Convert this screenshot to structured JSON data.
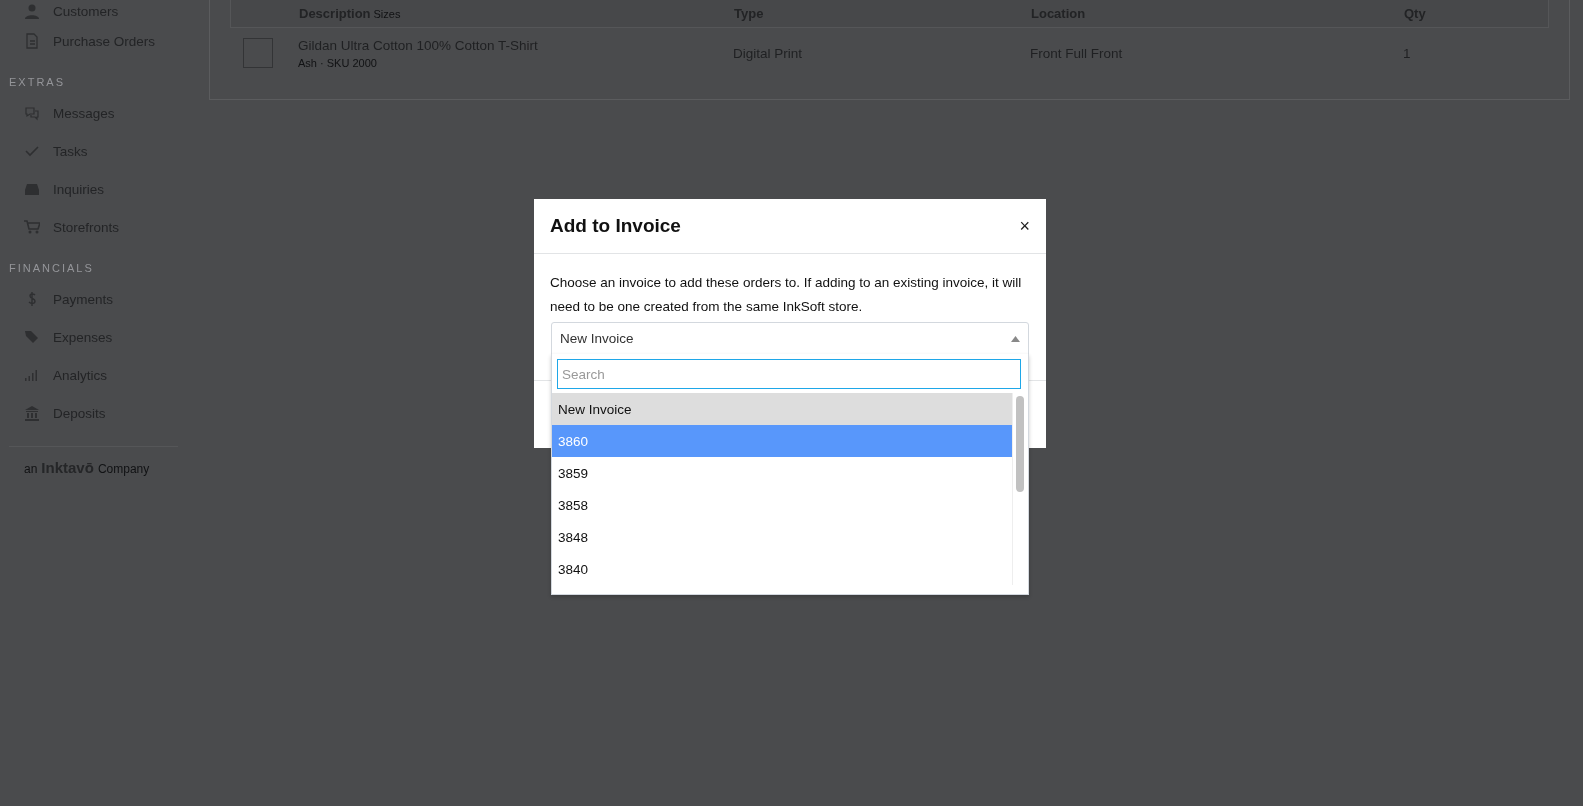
{
  "sidebar": {
    "sections": [
      {
        "items": [
          {
            "label": "Customers"
          },
          {
            "label": "Purchase Orders"
          }
        ]
      },
      {
        "heading": "EXTRAS",
        "items": [
          {
            "label": "Messages"
          },
          {
            "label": "Tasks"
          },
          {
            "label": "Inquiries"
          },
          {
            "label": "Storefronts"
          }
        ]
      },
      {
        "heading": "FINANCIALS",
        "items": [
          {
            "label": "Payments"
          },
          {
            "label": "Expenses"
          },
          {
            "label": "Analytics"
          },
          {
            "label": "Deposits"
          }
        ]
      }
    ],
    "footer": {
      "prefix": "an",
      "brand": "Inktavō",
      "suffix": "Company"
    }
  },
  "table": {
    "columns": [
      {
        "label": "Description",
        "sub": "Sizes"
      },
      {
        "label": "Type"
      },
      {
        "label": "Location"
      },
      {
        "label": "Qty"
      }
    ],
    "rows": [
      {
        "name": "Gildan Ultra Cotton 100% Cotton T-Shirt",
        "detail": "Ash · SKU 2000",
        "type": "Digital Print",
        "location": "Front Full Front",
        "qty": "1"
      }
    ]
  },
  "modal": {
    "title": "Add to Invoice",
    "close": "×",
    "message": "Choose an invoice to add these orders to. If adding to an existing invoice, it will need to be one created from the same InkSoft store.",
    "select": {
      "value": "New Invoice",
      "expanded": true
    },
    "search": {
      "placeholder": "Search"
    },
    "options": [
      {
        "label": "New Invoice",
        "selected": true,
        "highlighted": false
      },
      {
        "label": "3860",
        "selected": false,
        "highlighted": true
      },
      {
        "label": "3859",
        "selected": false,
        "highlighted": false
      },
      {
        "label": "3858",
        "selected": false,
        "highlighted": false
      },
      {
        "label": "3848",
        "selected": false,
        "highlighted": false
      },
      {
        "label": "3840",
        "selected": false,
        "highlighted": false
      }
    ]
  }
}
